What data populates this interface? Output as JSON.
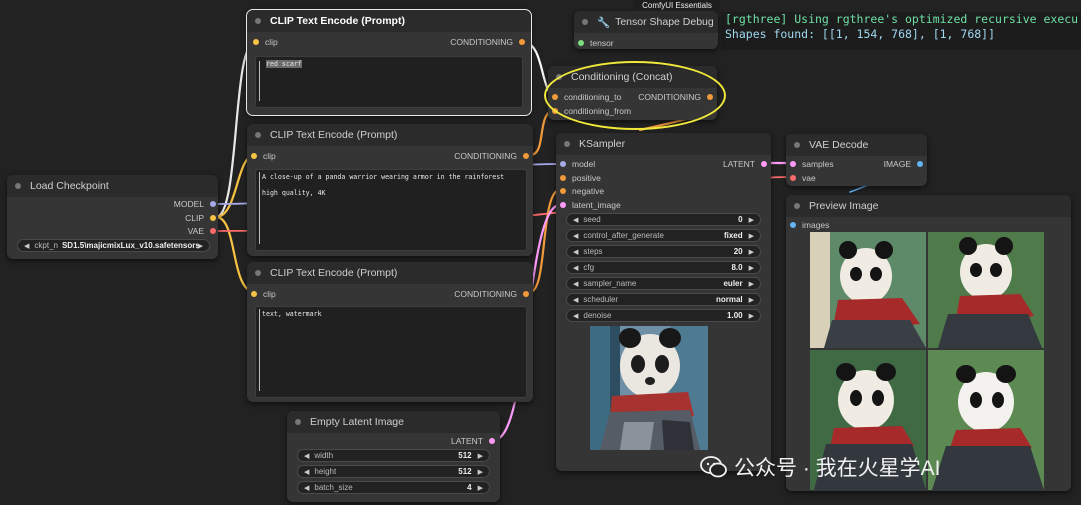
{
  "badge": "ComfyUI Essentials",
  "terminal": {
    "line1": "[rgthree] Using rgthree's optimized recursive execu",
    "line2": "Shapes found: [[1, 154, 768], [1, 768]]"
  },
  "nodes": {
    "clip1": {
      "title": "CLIP Text Encode (Prompt)",
      "in": "clip",
      "out": "CONDITIONING",
      "text": "red scarf"
    },
    "clip2": {
      "title": "CLIP Text Encode (Prompt)",
      "in": "clip",
      "out": "CONDITIONING",
      "text1": "A close-up of a panda warrior wearing armor in the rainforest",
      "text2": "high quality, 4K"
    },
    "clip3": {
      "title": "CLIP Text Encode (Prompt)",
      "in": "clip",
      "out": "CONDITIONING",
      "text": "text, watermark"
    },
    "tensor": {
      "title": "Tensor Shape Debug",
      "in": "tensor"
    },
    "concat": {
      "title": "Conditioning (Concat)",
      "in1": "conditioning_to",
      "in2": "conditioning_from",
      "out": "CONDITIONING"
    },
    "checkpoint": {
      "title": "Load Checkpoint",
      "out1": "MODEL",
      "out2": "CLIP",
      "out3": "VAE",
      "ckpt_name": "ckpt_n",
      "ckpt_value": "SD1.5\\majicmixLux_v10.safetensors"
    },
    "ksampler": {
      "title": "KSampler",
      "inputs": [
        "model",
        "positive",
        "negative",
        "latent_image"
      ],
      "out": "LATENT",
      "widgets": [
        {
          "name": "seed",
          "value": "0"
        },
        {
          "name": "control_after_generate",
          "value": "fixed"
        },
        {
          "name": "steps",
          "value": "20"
        },
        {
          "name": "cfg",
          "value": "8.0"
        },
        {
          "name": "sampler_name",
          "value": "euler"
        },
        {
          "name": "scheduler",
          "value": "normal"
        },
        {
          "name": "denoise",
          "value": "1.00"
        }
      ]
    },
    "vae": {
      "title": "VAE Decode",
      "in1": "samples",
      "in2": "vae",
      "out": "IMAGE"
    },
    "preview": {
      "title": "Preview Image",
      "in": "images"
    },
    "latent": {
      "title": "Empty Latent Image",
      "out": "LATENT",
      "widgets": [
        {
          "name": "width",
          "value": "512"
        },
        {
          "name": "height",
          "value": "512"
        },
        {
          "name": "batch_size",
          "value": "4"
        }
      ]
    }
  },
  "watermark": "公众号 · 我在火星学AI",
  "colors": {
    "clip": "#f6c343",
    "conditioning": "#f19a3c",
    "model": "#a8a8e8",
    "vae": "#ff6b6b",
    "latent": "#ff9cf9",
    "image": "#64b5f6",
    "tensor": "#7ee07e"
  }
}
